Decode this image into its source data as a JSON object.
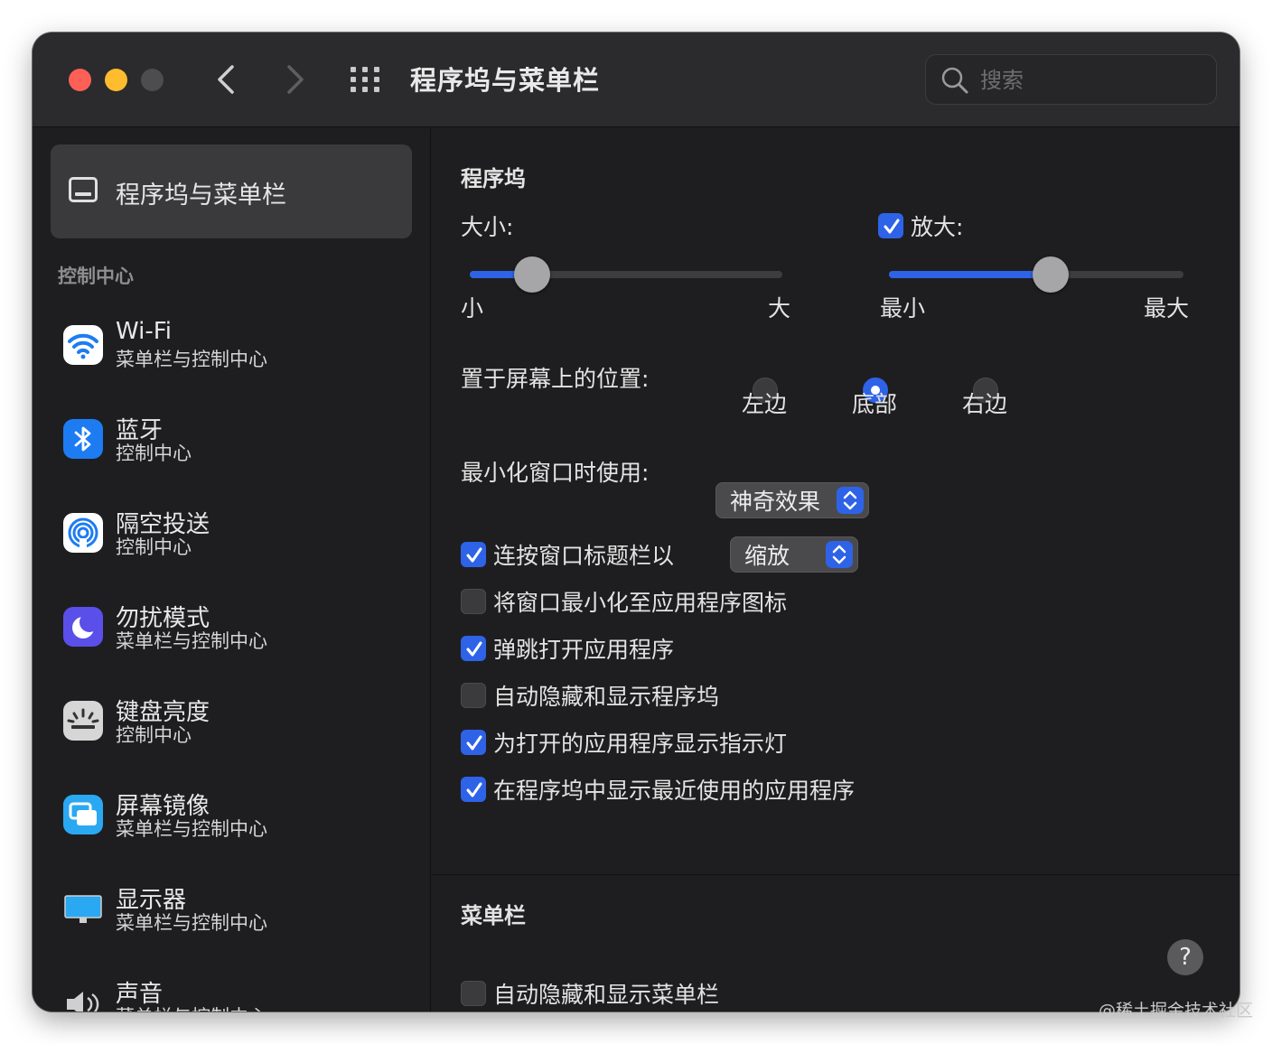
{
  "window": {
    "title": "程序坞与菜单栏",
    "search_placeholder": "搜索"
  },
  "sidebar": {
    "selected": {
      "label": "程序坞与菜单栏",
      "icon": "dock-icon"
    },
    "section_header": "控制中心",
    "items": [
      {
        "name": "Wi-Fi",
        "sub": "菜单栏与控制中心",
        "icon": "wifi-icon"
      },
      {
        "name": "蓝牙",
        "sub": "控制中心",
        "icon": "bluetooth-icon"
      },
      {
        "name": "隔空投送",
        "sub": "控制中心",
        "icon": "airdrop-icon"
      },
      {
        "name": "勿扰模式",
        "sub": "菜单栏与控制中心",
        "icon": "moon-icon"
      },
      {
        "name": "键盘亮度",
        "sub": "控制中心",
        "icon": "keyboard-brightness-icon"
      },
      {
        "name": "屏幕镜像",
        "sub": "菜单栏与控制中心",
        "icon": "screen-mirroring-icon"
      },
      {
        "name": "显示器",
        "sub": "菜单栏与控制中心",
        "icon": "display-icon"
      },
      {
        "name": "声音",
        "sub": "菜单栏与控制中心",
        "icon": "speaker-icon"
      }
    ]
  },
  "dock": {
    "header": "程序坞",
    "size": {
      "label": "大小:",
      "min_label": "小",
      "max_label": "大",
      "value": 0.2
    },
    "magnification": {
      "label": "放大:",
      "checked": true,
      "min_label": "最小",
      "max_label": "最大",
      "value": 0.55
    },
    "position": {
      "label": "置于屏幕上的位置:",
      "options": [
        "左边",
        "底部",
        "右边"
      ],
      "selected": "底部"
    },
    "minimize_using": {
      "label": "最小化窗口时使用:",
      "value": "神奇效果"
    },
    "double_click": {
      "label": "连按窗口标题栏以",
      "checked": true,
      "value": "缩放"
    },
    "checkboxes": [
      {
        "label": "将窗口最小化至应用程序图标",
        "checked": false
      },
      {
        "label": "弹跳打开应用程序",
        "checked": true
      },
      {
        "label": "自动隐藏和显示程序坞",
        "checked": false
      },
      {
        "label": "为打开的应用程序显示指示灯",
        "checked": true
      },
      {
        "label": "在程序坞中显示最近使用的应用程序",
        "checked": true
      }
    ]
  },
  "menubar": {
    "header": "菜单栏",
    "autohide": {
      "label": "自动隐藏和显示菜单栏",
      "checked": false
    }
  },
  "help": "?",
  "watermark": "@稀土掘金技术社区",
  "colors": {
    "accent": "#2e63e8",
    "window_bg": "#1e1e20",
    "titlebar": "#2b2b2d"
  }
}
